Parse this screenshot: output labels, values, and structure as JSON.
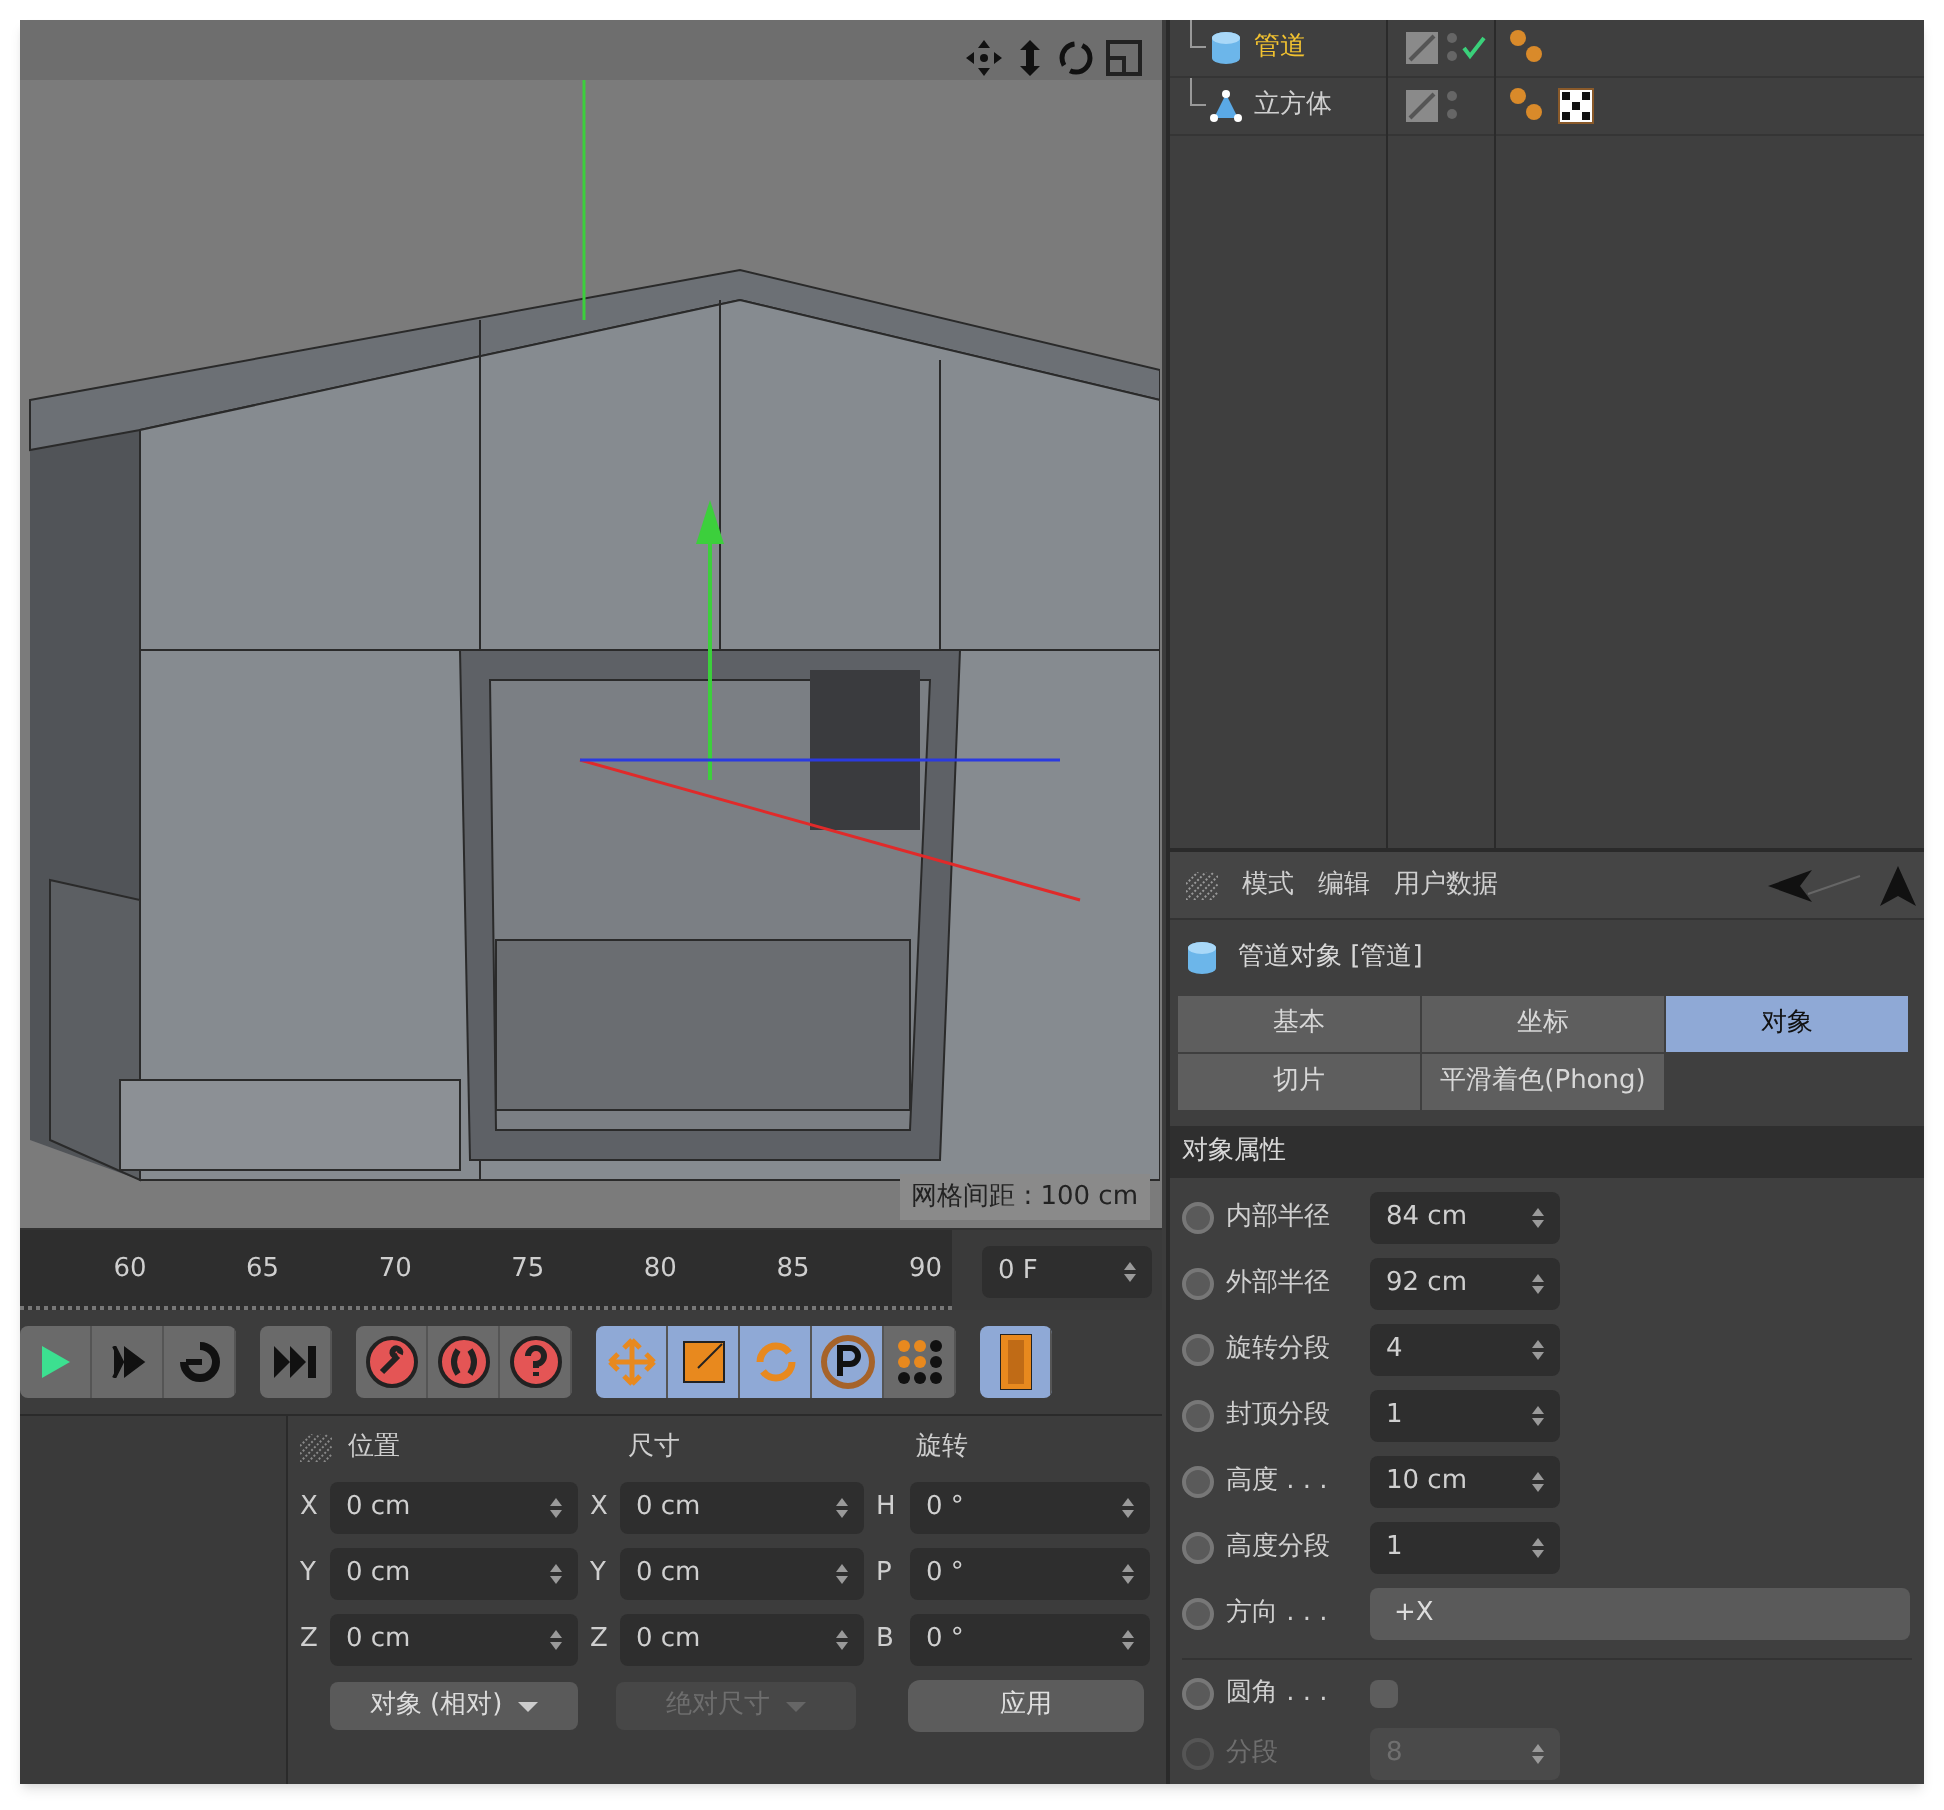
{
  "viewport": {
    "grid_label": "网格间距 : 100 cm"
  },
  "object_manager": {
    "rows": [
      {
        "name": "管道",
        "kind": "tube",
        "selected": true,
        "checked": true,
        "texture_tag": false
      },
      {
        "name": "立方体",
        "kind": "cube",
        "selected": false,
        "checked": false,
        "texture_tag": true
      }
    ]
  },
  "timeline": {
    "ticks": [
      "60",
      "65",
      "70",
      "75",
      "80",
      "85",
      "90"
    ],
    "frame": "0 F"
  },
  "coordinates": {
    "headers": [
      "位置",
      "尺寸",
      "旋转"
    ],
    "rows": [
      {
        "pos_axis": "X",
        "pos": "0 cm",
        "size_axis": "X",
        "size": "0 cm",
        "rot_axis": "H",
        "rot": "0 °"
      },
      {
        "pos_axis": "Y",
        "pos": "0 cm",
        "size_axis": "Y",
        "size": "0 cm",
        "rot_axis": "P",
        "rot": "0 °"
      },
      {
        "pos_axis": "Z",
        "pos": "0 cm",
        "size_axis": "Z",
        "size": "0 cm",
        "rot_axis": "B",
        "rot": "0 °"
      }
    ],
    "mode_dropdown": "对象 (相对)",
    "size_dropdown": {
      "label": "绝对尺寸",
      "disabled": true
    },
    "apply": "应用"
  },
  "attributes": {
    "menu": [
      "模式",
      "编辑",
      "用户数据"
    ],
    "title": "管道对象 [管道]",
    "tabs": [
      {
        "label": "基本",
        "selected": false
      },
      {
        "label": "坐标",
        "selected": false
      },
      {
        "label": "对象",
        "selected": true
      },
      {
        "label": "切片",
        "selected": false
      },
      {
        "label": "平滑着色(Phong)",
        "selected": false
      }
    ],
    "section": "对象属性",
    "properties": [
      {
        "kind": "number",
        "label": "内部半径",
        "value": "84 cm",
        "disabled": false,
        "animated": false
      },
      {
        "kind": "number",
        "label": "外部半径",
        "value": "92 cm",
        "disabled": false,
        "animated": false
      },
      {
        "kind": "number",
        "label": "旋转分段",
        "value": "4",
        "disabled": false,
        "animated": false
      },
      {
        "kind": "number",
        "label": "封顶分段",
        "value": "1",
        "disabled": false,
        "animated": false
      },
      {
        "kind": "number",
        "label": "高度 . . .",
        "value": "10 cm",
        "disabled": false,
        "animated": false
      },
      {
        "kind": "number",
        "label": "高度分段",
        "value": "1",
        "disabled": false,
        "animated": false
      },
      {
        "kind": "dropdown",
        "label": "方向 . . .",
        "value": "+X",
        "disabled": false,
        "animated": false
      },
      {
        "kind": "checkbox",
        "label": "圆角 . . .",
        "checked": false,
        "disabled": false,
        "animated": false
      },
      {
        "kind": "number",
        "label": "分段",
        "value": "8",
        "disabled": true,
        "animated": false
      }
    ]
  }
}
